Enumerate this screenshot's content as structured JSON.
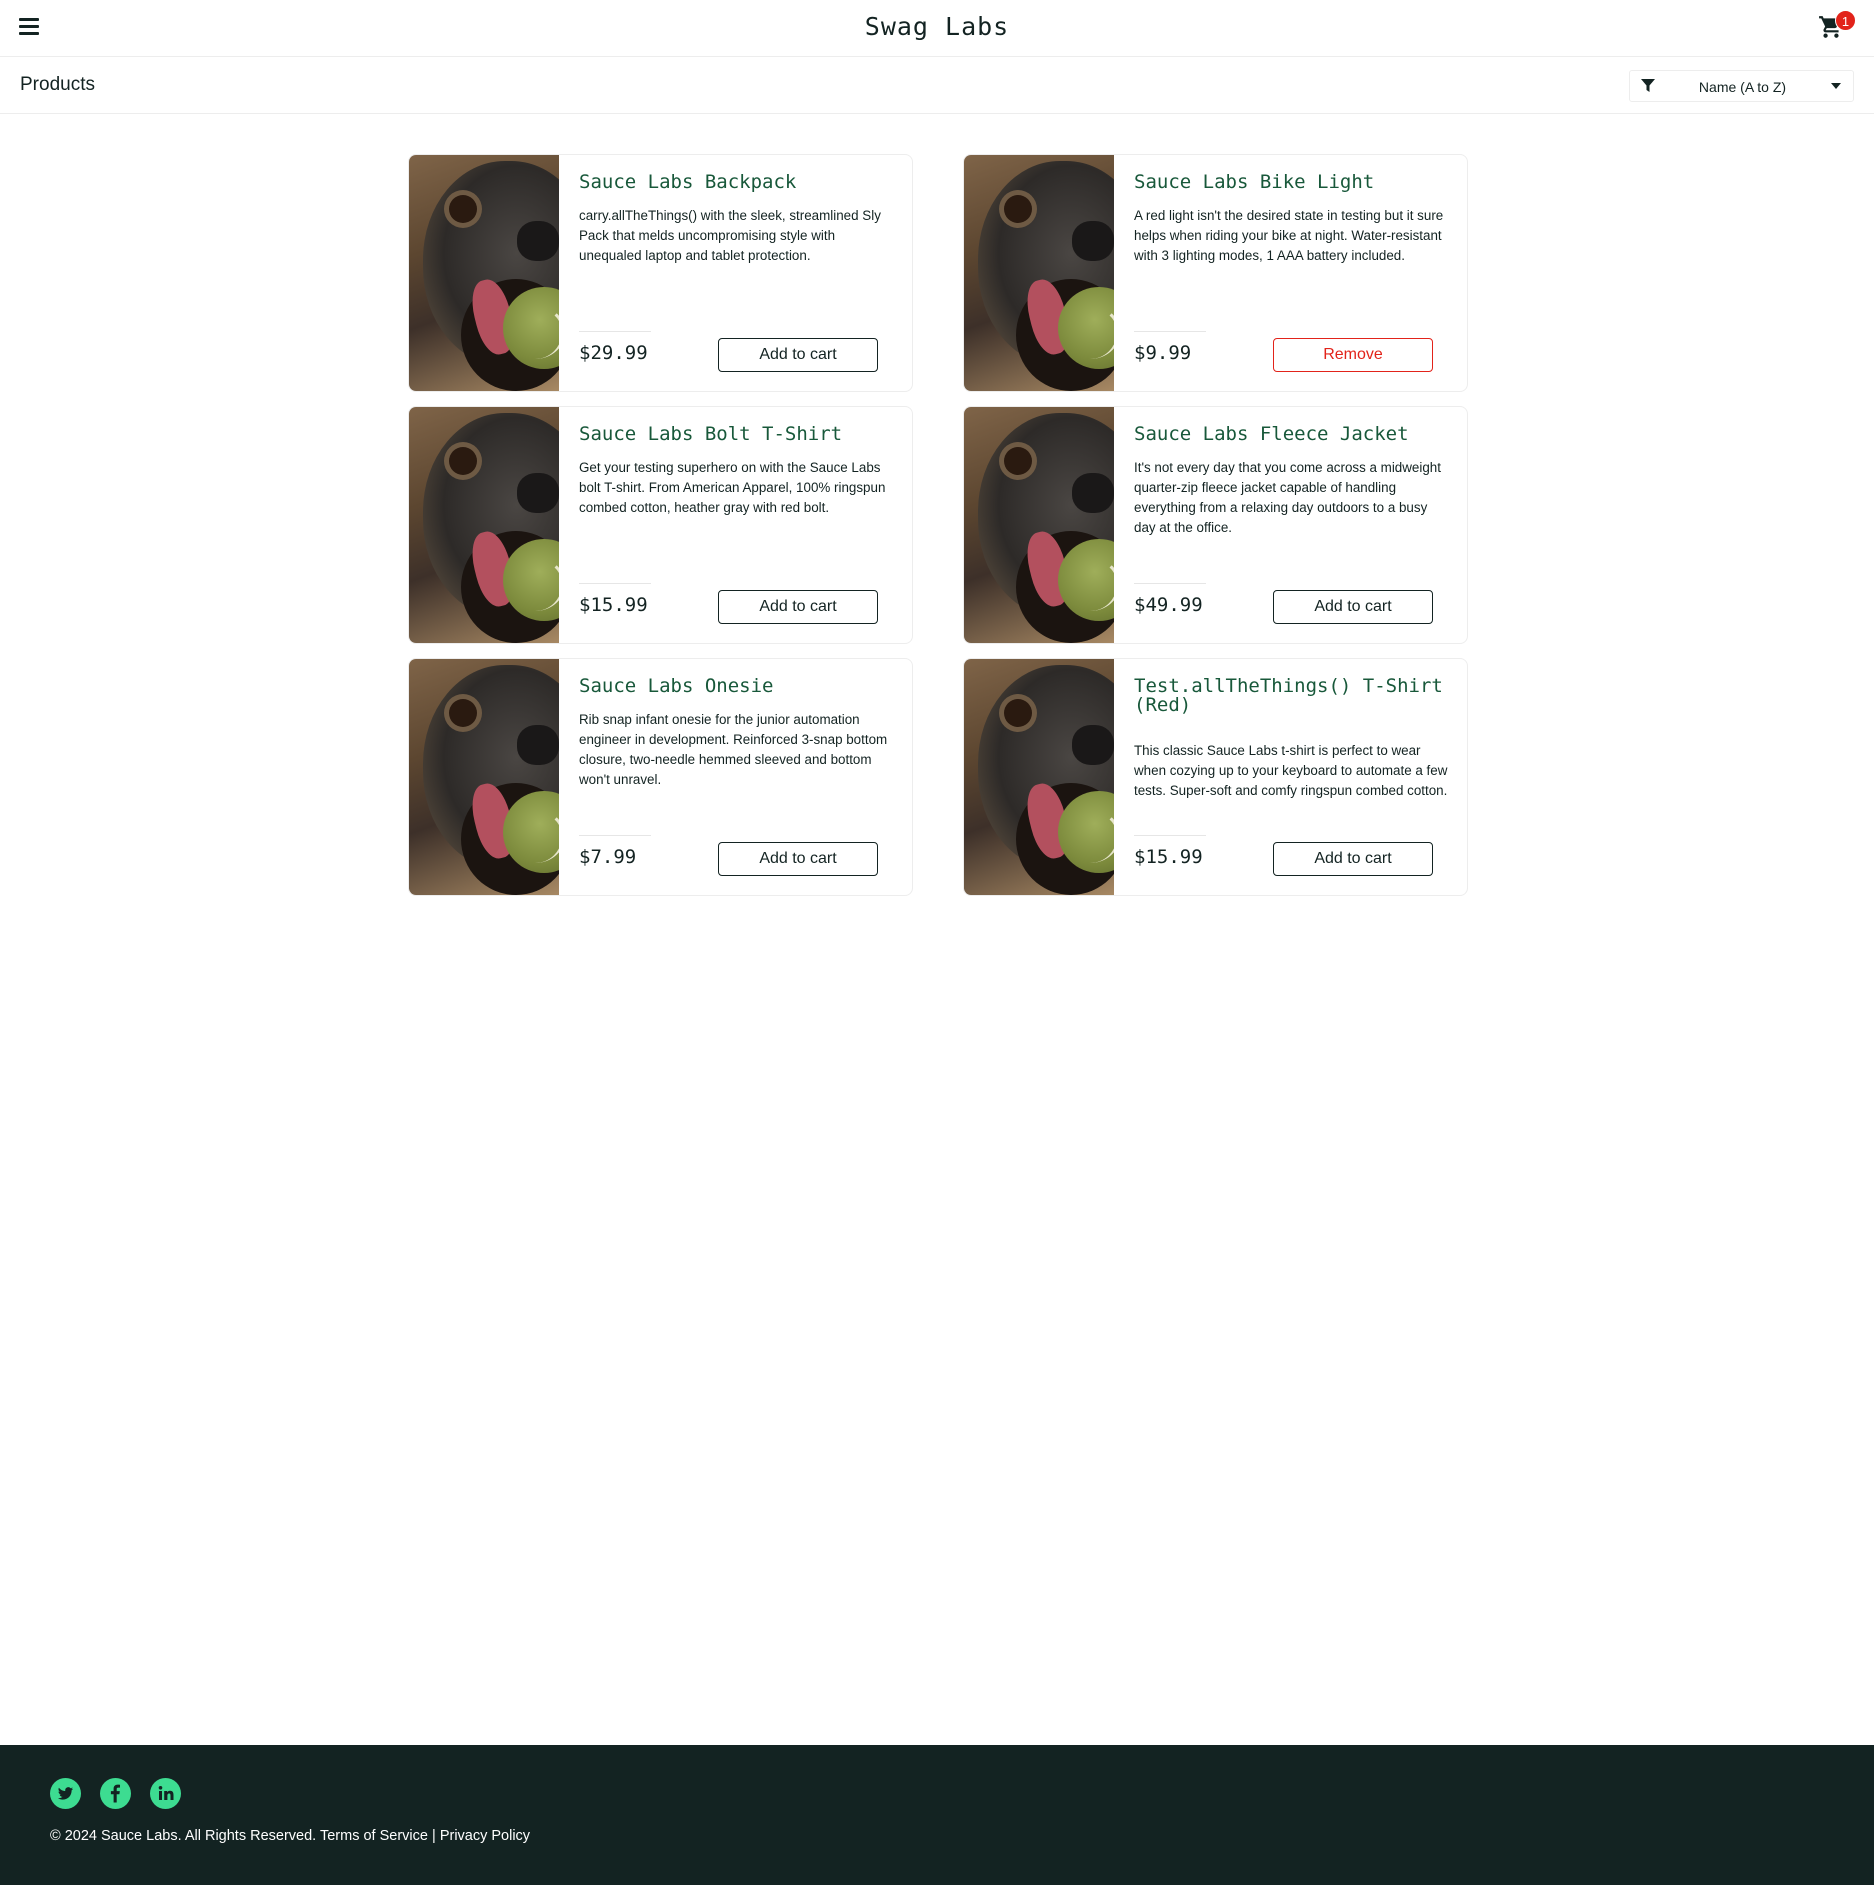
{
  "header": {
    "logo": "Swag Labs",
    "cart_count": "1"
  },
  "subheader": {
    "title": "Products",
    "sort_selected": "Name (A to Z)"
  },
  "products": [
    {
      "name": "Sauce Labs Backpack",
      "description": "carry.allTheThings() with the sleek, streamlined Sly Pack that melds uncompromising style with unequaled laptop and tablet protection.",
      "price": "$29.99",
      "button": "Add to cart"
    },
    {
      "name": "Sauce Labs Bike Light",
      "description": "A red light isn't the desired state in testing but it sure helps when riding your bike at night. Water-resistant with 3 lighting modes, 1 AAA battery included.",
      "price": "$9.99",
      "button": "Remove"
    },
    {
      "name": "Sauce Labs Bolt T-Shirt",
      "description": "Get your testing superhero on with the Sauce Labs bolt T-shirt. From American Apparel, 100% ringspun combed cotton, heather gray with red bolt.",
      "price": "$15.99",
      "button": "Add to cart"
    },
    {
      "name": "Sauce Labs Fleece Jacket",
      "description": "It's not every day that you come across a midweight quarter-zip fleece jacket capable of handling everything from a relaxing day outdoors to a busy day at the office.",
      "price": "$49.99",
      "button": "Add to cart"
    },
    {
      "name": "Sauce Labs Onesie",
      "description": "Rib snap infant onesie for the junior automation engineer in development. Reinforced 3-snap bottom closure, two-needle hemmed sleeved and bottom won't unravel.",
      "price": "$7.99",
      "button": "Add to cart"
    },
    {
      "name": "Test.allTheThings() T-Shirt (Red)",
      "description": "This classic Sauce Labs t-shirt is perfect to wear when cozying up to your keyboard to automate a few tests. Super-soft and comfy ringspun combed cotton.",
      "price": "$15.99",
      "button": "Add to cart"
    }
  ],
  "footer": {
    "copyright": "© 2024 Sauce Labs. All Rights Reserved.",
    "terms": "Terms of Service",
    "separator": "|",
    "privacy": "Privacy Policy",
    "social": [
      "twitter-icon",
      "facebook-icon",
      "linkedin-icon"
    ]
  },
  "colors": {
    "accent": "#3ddc91",
    "dark": "#132322",
    "product_name": "#18583a",
    "badge": "#e2231a"
  }
}
